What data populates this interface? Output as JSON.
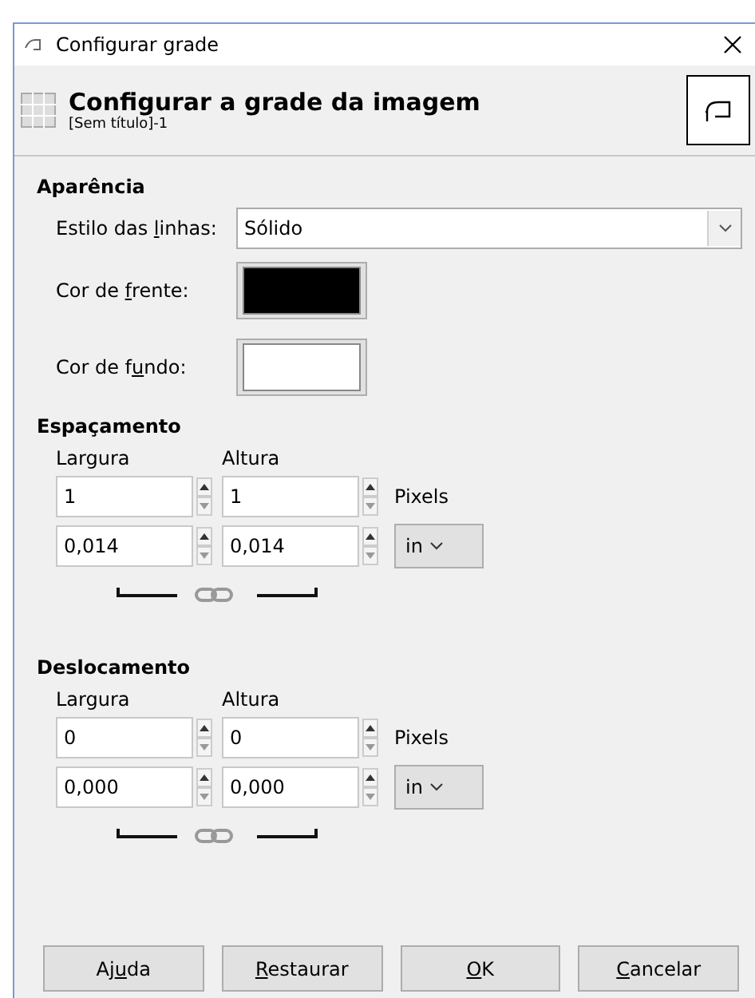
{
  "window": {
    "title": "Configurar grade"
  },
  "header": {
    "title": "Configurar a grade da imagem",
    "subtitle": "[Sem título]-1"
  },
  "appearance": {
    "heading": "Aparência",
    "line_style": {
      "label": {
        "before": "Estilo das ",
        "key": "l",
        "after": "inhas:"
      },
      "value": "Sólido"
    },
    "colors": [
      {
        "label": {
          "before": "Cor de ",
          "key": "f",
          "after": "rente:"
        },
        "color": "#000000"
      },
      {
        "label": {
          "before": "Cor de f",
          "key": "u",
          "after": "ndo:"
        },
        "color": "#ffffff"
      }
    ]
  },
  "sections": [
    {
      "heading": "Espaçamento",
      "columns": [
        "Largura",
        "Altura"
      ],
      "pixel_values": [
        "1",
        "1"
      ],
      "pixel_unit": "Pixels",
      "unit_values": [
        "0,014",
        "0,014"
      ],
      "unit": "in"
    },
    {
      "heading": "Deslocamento",
      "columns": [
        "Largura",
        "Altura"
      ],
      "pixel_values": [
        "0",
        "0"
      ],
      "pixel_unit": "Pixels",
      "unit_values": [
        "0,000",
        "0,000"
      ],
      "unit": "in"
    }
  ],
  "buttons": [
    {
      "label": {
        "before": "Aj",
        "key": "u",
        "after": "da"
      }
    },
    {
      "label": {
        "key": "R",
        "after": "estaurar"
      }
    },
    {
      "label": {
        "key": "O",
        "after": "K"
      }
    },
    {
      "label": {
        "key": "C",
        "after": "ancelar"
      }
    }
  ]
}
